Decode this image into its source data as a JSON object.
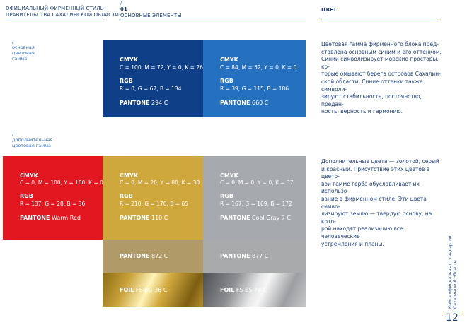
{
  "header": {
    "left_line1": "ОФИЦИАЛЬНЫЙ ФИРМЕННЫЙ СТИЛЬ",
    "left_line2": "ПРАВИТЕЛЬСТВА САХАЛИНСКОЙ ОБЛАСТИ",
    "mid_slash": "/",
    "mid_num": "01",
    "mid_title": "ОСНОВНЫЕ ЭЛЕМЕНТЫ",
    "right_title": "ЦВЕТ"
  },
  "section_main": {
    "slash": "/",
    "line1": "основная",
    "line2": "цветовая",
    "line3": "гамма"
  },
  "section_extra": {
    "slash": "/",
    "line1": "дополнительная",
    "line2": "цветовая гамма"
  },
  "colors": {
    "blue_dark": "#0f3f86",
    "blue_light": "#2570bf",
    "red": "#e3171f",
    "gold": "#cfa83d",
    "gray": "#a6a9ad",
    "gold_872": "#b09a68",
    "gray_877": "#a8aaab",
    "text_dark": "#1f3f7a"
  },
  "swatches": {
    "blue_dark": {
      "cmyk_label": "CMYK",
      "cmyk": "C = 100, M = 72, Y = 0, K = 26",
      "rgb_label": "RGB",
      "rgb": "R = 0, G = 67, B = 134",
      "pantone_label": "PANTONE",
      "pantone": "294 C"
    },
    "blue_light": {
      "cmyk_label": "CMYK",
      "cmyk": "C = 84, M = 52, Y = 0, K = 0",
      "rgb_label": "RGB",
      "rgb": "R = 39, G = 115, B = 186",
      "pantone_label": "PANTONE",
      "pantone": "660 C"
    },
    "red": {
      "cmyk_label": "CMYK",
      "cmyk": "C = 0, M = 100, Y = 100, K = 0",
      "rgb_label": "RGB",
      "rgb": "R = 137, G = 28, B = 36",
      "pantone_label": "PANTONE",
      "pantone": "Warm Red"
    },
    "gold": {
      "cmyk_label": "CMYK",
      "cmyk": "C = 0, M = 20, Y = 80, K = 30",
      "rgb_label": "RGB",
      "rgb": "R = 210, G = 170, B = 65",
      "pantone_label": "PANTONE",
      "pantone": "110 C"
    },
    "gray": {
      "cmyk_label": "CMYK",
      "cmyk": "C = 0, M = 0, Y = 0, K = 37",
      "rgb_label": "RGB",
      "rgb": "R = 167, G = 169, B = 172",
      "pantone_label": "PANTONE",
      "pantone": "Cool Gray 7 C"
    },
    "gold_872": {
      "pantone_label": "PANTONE",
      "pantone": "872 C"
    },
    "gray_877": {
      "pantone_label": "PANTONE",
      "pantone": "877 C"
    },
    "foil_gold": {
      "foil_label": "FOIL",
      "foil": "FS-BG 36 C"
    },
    "foil_silver": {
      "foil_label": "FOIL",
      "foil": "FS-BS 78 C"
    }
  },
  "text_main": {
    "l1": "Цветовая гамма фирменного блока пред-",
    "l2": "ставлена основным синим и его оттенком.",
    "l3": "Синий символизирует морские просторы, ко-",
    "l4": "торые омывают берега островов Сахалин-",
    "l5": "ской области. Синие оттенки также символи-",
    "l6": "зируют стабильность, постоянство, предан-",
    "l7": "ность, верность и гармонию."
  },
  "text_extra": {
    "l1": "Дополнительные цвета — золотой, серый",
    "l2": "и красный. Присутствие этих цветов в цвето-",
    "l3": "вой гамме герба обуславливает их использо-",
    "l4": "вание в фирменном стиле. Эти цвета симво-",
    "l5": "лизируют землю — твердую основу, на кото-",
    "l6": "рой находят реализацию все человеческие",
    "l7": "устремления и планы."
  },
  "footer": {
    "vert_line1": "Книга официальных стандартов",
    "vert_line2": "Сахалинской области",
    "page_number": "12"
  }
}
